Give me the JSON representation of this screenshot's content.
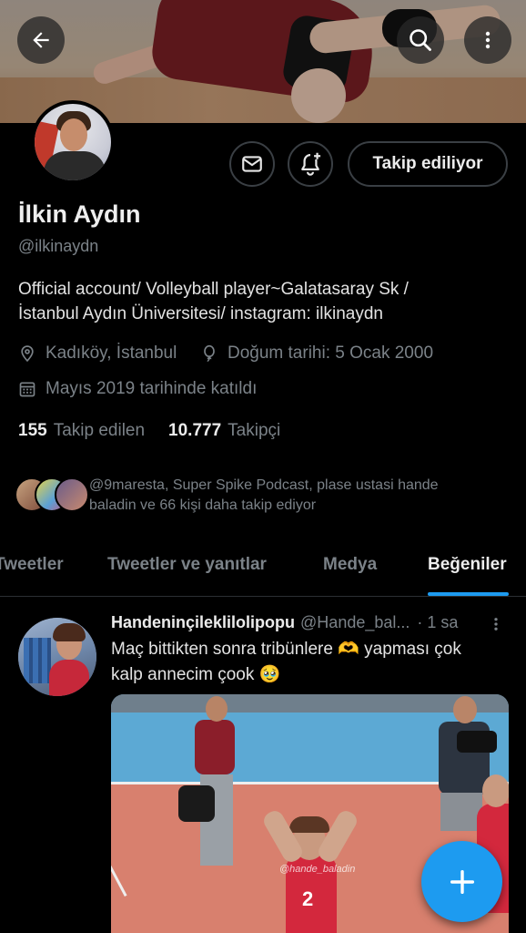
{
  "profile": {
    "name": "İlkin Aydın",
    "handle": "@ilkinaydn",
    "bio_line1": "Official account/ Volleyball player~Galatasaray Sk /",
    "bio_line2": "İstanbul Aydın Üniversitesi/ instagram: ilkinaydn",
    "location": "Kadıköy, İstanbul",
    "birthday": "Doğum tarihi: 5 Ocak 2000",
    "joined": "Mayıs 2019 tarihinde katıldı",
    "following_count": "155",
    "following_label": "Takip edilen",
    "followers_count": "10.777",
    "followers_label": "Takipçi",
    "follow_button_label": "Takip ediliyor",
    "followed_by_line1": "@9maresta, Super Spike Podcast, plase ustasi hande",
    "followed_by_line2": "baladin ve 66 kişi daha takip ediyor"
  },
  "tabs": [
    {
      "label": "Tweetler"
    },
    {
      "label": "Tweetler ve yanıtlar"
    },
    {
      "label": "Medya"
    },
    {
      "label": "Beğeniler"
    }
  ],
  "active_tab": "Beğeniler",
  "tweet": {
    "author_name": "Handeninçileklilolipopu",
    "author_handle": "@Hande_bal...",
    "time": "· 1 sa",
    "text_line1": "Maç bittikten sonra tribünlere 🫶 yapması çok",
    "text_line2": "kalp annecim çook 🥹",
    "media_watermark": "@hande_baladin"
  },
  "colors": {
    "background": "#000000",
    "accent": "#1d9bf0",
    "muted_text": "#7b8288",
    "primary_text": "#ececec"
  },
  "icons": {
    "back": "arrow-left-icon",
    "search": "search-icon",
    "more": "more-vertical-icon",
    "message": "envelope-icon",
    "notify": "bell-plus-icon",
    "location": "location-pin-icon",
    "birthday": "balloon-icon",
    "calendar": "calendar-icon",
    "compose": "plus-icon"
  }
}
